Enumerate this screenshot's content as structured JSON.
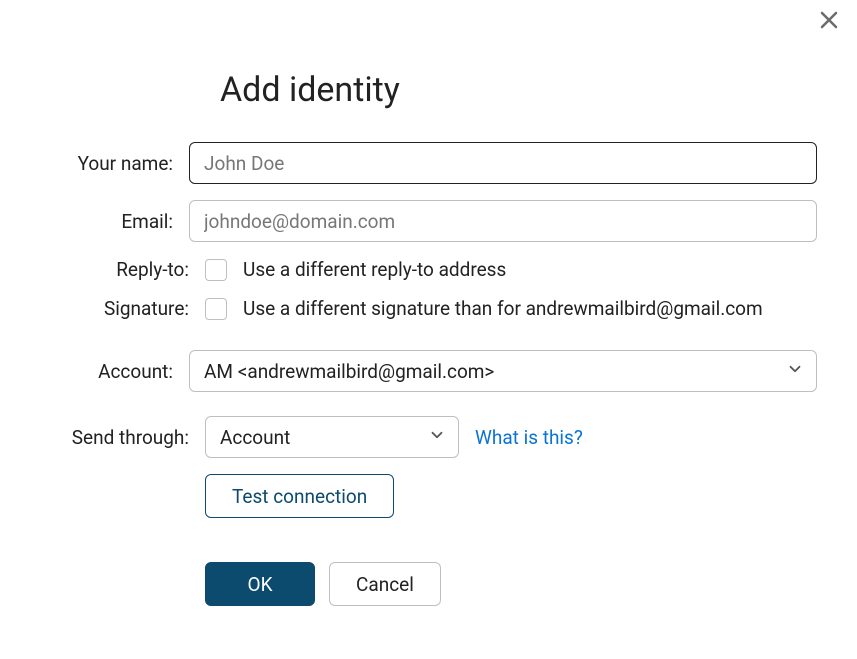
{
  "title": "Add identity",
  "close_icon": "close-icon",
  "fields": {
    "your_name": {
      "label": "Your name:",
      "value": "",
      "placeholder": "John Doe"
    },
    "email": {
      "label": "Email:",
      "value": "",
      "placeholder": "johndoe@domain.com"
    },
    "reply_to": {
      "label": "Reply-to:",
      "checkbox_label": "Use a different reply-to address",
      "checked": false
    },
    "signature": {
      "label": "Signature:",
      "checkbox_label": "Use a different signature than for andrewmailbird@gmail.com",
      "checked": false
    },
    "account": {
      "label": "Account:",
      "selected": "AM <andrewmailbird@gmail.com>"
    },
    "send_through": {
      "label": "Send through:",
      "selected": "Account",
      "help_link": "What is this?"
    }
  },
  "buttons": {
    "test_connection": "Test connection",
    "ok": "OK",
    "cancel": "Cancel"
  }
}
